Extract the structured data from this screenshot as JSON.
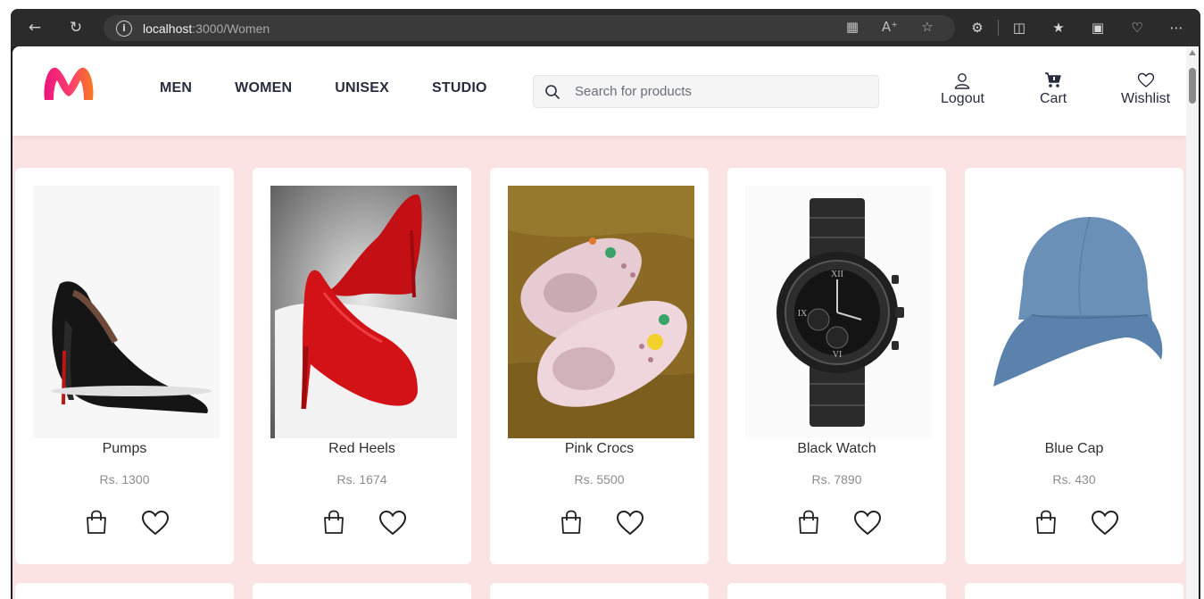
{
  "browser": {
    "url_host": "localhost",
    "url_path": ":3000/Women"
  },
  "header": {
    "nav": [
      "MEN",
      "WOMEN",
      "UNISEX",
      "STUDIO"
    ],
    "search_placeholder": "Search for products",
    "actions": {
      "logout": "Logout",
      "cart": "Cart",
      "wishlist": "Wishlist"
    },
    "brand_colors": {
      "logo_start": "#ff3f6c",
      "logo_end": "#f7a41b"
    }
  },
  "products": [
    {
      "name": "Pumps",
      "price": "Rs. 1300"
    },
    {
      "name": "Red Heels",
      "price": "Rs. 1674"
    },
    {
      "name": "Pink Crocs",
      "price": "Rs. 5500"
    },
    {
      "name": "Black Watch",
      "price": "Rs. 7890"
    },
    {
      "name": "Blue Cap",
      "price": "Rs. 430"
    }
  ],
  "colors": {
    "page_bg": "#fbe3e4",
    "card_bg": "#ffffff",
    "text_dark": "#282c3f",
    "price_text": "#8c8c8c"
  }
}
